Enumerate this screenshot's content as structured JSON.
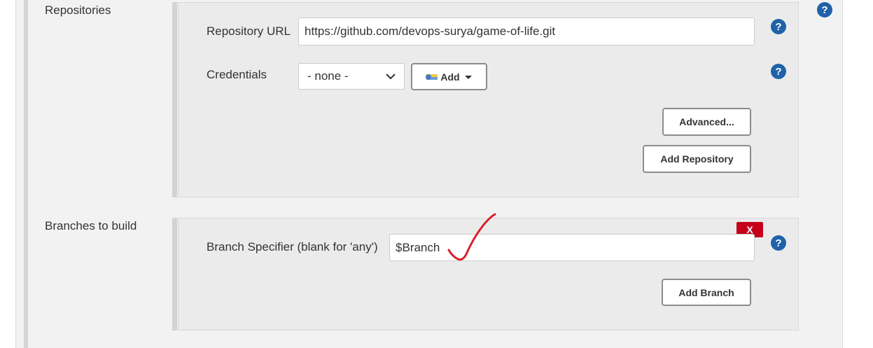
{
  "repositories": {
    "section_label": "Repositories",
    "repository_url": {
      "label": "Repository URL",
      "value": "https://github.com/devops-surya/game-of-life.git"
    },
    "credentials": {
      "label": "Credentials",
      "selected": "- none -",
      "add_button": "Add"
    },
    "advanced_button": "Advanced...",
    "add_repository_button": "Add Repository"
  },
  "branches": {
    "section_label": "Branches to build",
    "branch_specifier": {
      "label": "Branch Specifier (blank for 'any')",
      "value": "$Branch"
    },
    "delete_button": "X",
    "add_branch_button": "Add Branch"
  },
  "help_glyph": "?",
  "colors": {
    "help_icon": "#1f62a8",
    "delete_button": "#c4001a",
    "annotation_check": "#d9202a"
  }
}
